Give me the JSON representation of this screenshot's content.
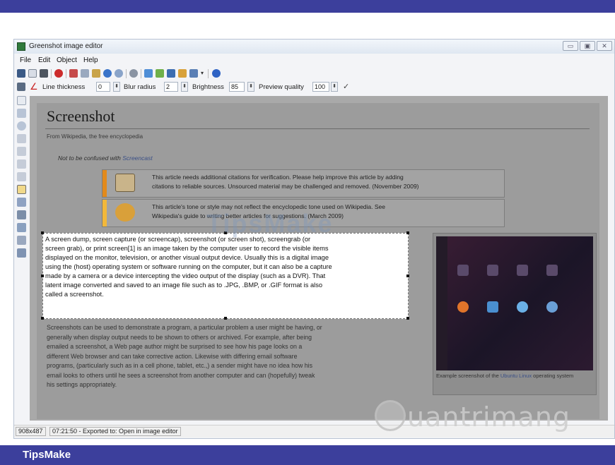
{
  "window": {
    "title": "Greenshot image editor",
    "buttons": [
      "▭",
      "▣",
      "✕"
    ]
  },
  "menu": [
    "File",
    "Edit",
    "Object",
    "Help"
  ],
  "toolbar2": {
    "line_thickness_label": "Line thickness",
    "line_thickness_value": "0",
    "blur_radius_label": "Blur radius",
    "blur_radius_value": "2",
    "brightness_label": "Brightness",
    "brightness_value": "85",
    "preview_quality_label": "Preview quality",
    "preview_quality_value": "100"
  },
  "article": {
    "title": "Screenshot",
    "from": "From Wikipedia, the free encyclopedia",
    "not_confused_prefix": "Not to be confused with ",
    "not_confused_link": "Screencast",
    "ambox1_line1": "This article needs additional citations for verification. Please help improve this article by adding",
    "ambox1_line2": "citations to reliable sources. Unsourced material may be challenged and removed. (November 2009)",
    "ambox2_line1": "This article's tone or style may not reflect the encyclopedic tone used on Wikipedia. See",
    "ambox2_line2": "Wikipedia's guide to writing better articles for suggestions. (March 2009)",
    "highlight_lines": [
      "A screen dump, screen capture (or screencap), screenshot (or screen shot), screengrab (or",
      "screen grab), or print screen[1] is an image taken by the computer user to record the visible items",
      "displayed on the monitor, television, or another visual output device. Usually this is a digital image",
      "using the (host) operating system or software running on the computer, but it can also be a capture",
      "made by a camera or a device intercepting the video output of the display (such as a DVR). That",
      "latent image converted and saved to an image file such as to .JPG, .BMP, or .GIF format is also",
      "called a screenshot."
    ],
    "body_lines": [
      "Screenshots can be used to demonstrate a program, a particular problem a user might be having, or",
      "generally when display output needs to be shown to others or archived. For example, after being",
      "emailed a screenshot, a Web page author might be surprised to see how his page looks on a",
      "different Web browser and can take corrective action. Likewise with differing email software",
      "programs, (particularly such as in a cell phone, tablet, etc.,) a sender might have no idea how his",
      "email looks to others until he sees a screenshot from another computer and can (hopefully) tweak",
      "his settings appropriately."
    ],
    "caption_prefix": "Example screenshot of the ",
    "caption_link": "Ubuntu Linux",
    "caption_suffix": " operating system"
  },
  "overlay_watermark": "TipsMake",
  "status": {
    "size": "908x487",
    "message": "07:21:50 - Exported to: Open in image editor"
  },
  "watermark_logo": "uantrimang",
  "footer_brand": "TipsMake",
  "colors": {
    "frame_blue": "#3c3f9c",
    "ambox_orange": "#e28a1c",
    "ambox_yellow": "#f2b83a"
  }
}
